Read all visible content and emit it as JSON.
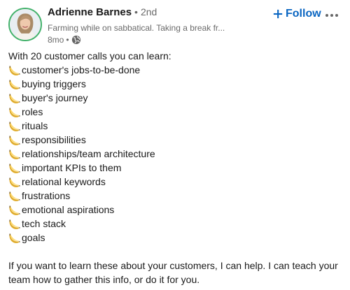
{
  "post": {
    "author": {
      "name": "Adrienne Barnes",
      "separator": "•",
      "degree": "2nd",
      "headline": "Farming while on sabbatical. Taking a break fr...",
      "time": "8mo",
      "time_separator": "•",
      "visibility_icon": "globe-icon",
      "avatar_ring_color": "#44b26c"
    },
    "follow_label": "Follow",
    "follow_icon": "plus-icon",
    "more_icon": "ellipsis-icon",
    "accent_color": "#0a66c2",
    "intro": "With 20 customer calls you can learn:",
    "bullet_icon": "banana-emoji-icon",
    "items": [
      " customer's jobs-to-be-done",
      " buying triggers",
      "buyer's journey",
      "roles",
      "rituals",
      "responsibilities",
      "relationships/team architecture",
      "important KPIs to them",
      "relational keywords",
      "frustrations",
      "emotional aspirations",
      "tech stack",
      "goals"
    ],
    "closing": "If you want to learn these about your customers, I can help. I can teach your team how to gather this info, or do it for you."
  }
}
